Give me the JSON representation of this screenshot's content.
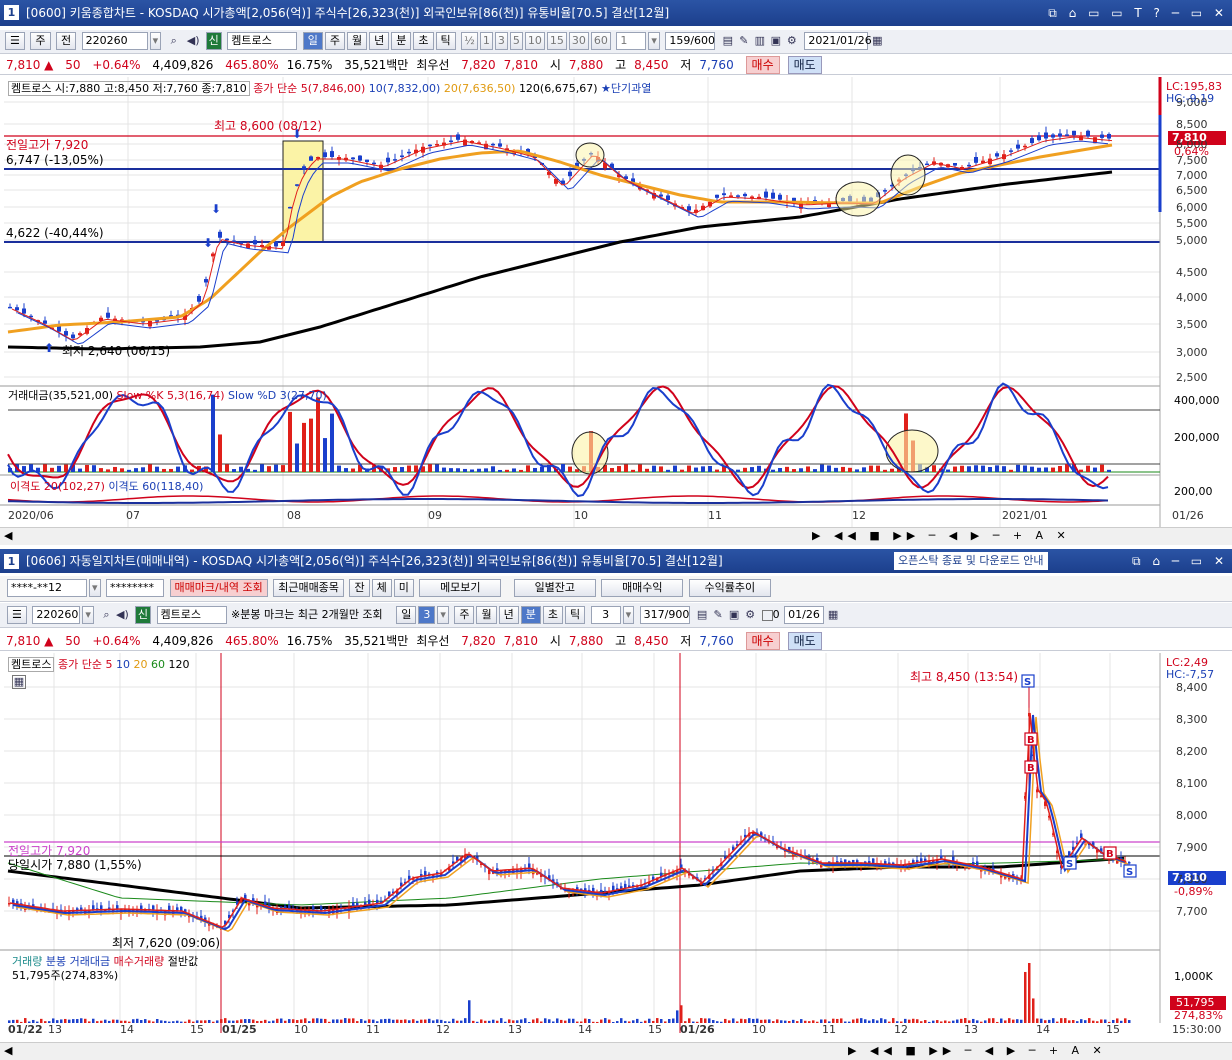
{
  "w1": {
    "title": "[0600] 키움종합차트 - KOSDAQ 시가총액[2,056(억)] 주식수[26,323(천)] 외국인보유[86(천)] 유통비율[70.5] 결산[12월]",
    "num": "1",
    "tb": {
      "week": "주",
      "jeon": "전",
      "code": "220260",
      "name": "켐트로스",
      "periods": [
        "일",
        "주",
        "월",
        "년",
        "분",
        "초",
        "틱"
      ],
      "ratios": [
        "½",
        "1",
        "3",
        "5",
        "10",
        "15",
        "30",
        "60"
      ],
      "one": "1",
      "count": "159/600",
      "date": "2021/01/26",
      "sin": "신"
    },
    "quote": {
      "price": "7,810 ▲",
      "chg": "50",
      "pct": "+0.64%",
      "vol": "4,409,826",
      "vr": "465.80%",
      "turn": "16.75%",
      "amt": "35,521백만",
      "bid_l": "최우선",
      "bid1": "7,820",
      "bid2": "7,810",
      "open_l": "시",
      "open": "7,880",
      "high_l": "고",
      "high": "8,450",
      "low_l": "저",
      "low": "7,760",
      "buy": "매수",
      "sell": "매도"
    },
    "legend": {
      "name": "켐트로스 시:7,880 고:8,450 저:7,760 종:7,810",
      "ma1": "종가 단순 5(7,846,00)",
      "ma2": "10(7,832,00)",
      "ma3": "20(7,636,50)",
      "ma4": "120(6,675,67)",
      "star": "★단기과열"
    },
    "labels": {
      "hi": "최고 8,600 (08/12)",
      "prev": "전일고가 7,920",
      "l1": "6,747 (-13,05%)",
      "l2": "4,622 (-40,44%)",
      "lo": "최저 2,640 (06/15)",
      "lc": "LC:195,83",
      "hc": "HC:-9,19",
      "px": "7,810",
      "pct": "0,64%"
    },
    "yticks": [
      "9,000",
      "8,500",
      "8,000",
      "7,500",
      "7,000",
      "6,500",
      "6,000",
      "5,500",
      "5,000",
      "4,500",
      "4,000",
      "3,500",
      "3,000",
      "2,500"
    ],
    "sub1": {
      "a": "거래대금(35,521,00)",
      "b": "Slow %K 5,3(16,74)",
      "c": "Slow %D 3(27,70)",
      "t1": "400,000",
      "t2": "200,000"
    },
    "sub2": {
      "a": "이격도 20(102,27)",
      "b": "이격도 60(118,40)",
      "t1": "200,00"
    },
    "xticks": [
      "2020/06",
      "07",
      "08",
      "09",
      "10",
      "11",
      "12",
      "2021/01",
      "01/26"
    ]
  },
  "w2": {
    "title": "[0606] 자동일지차트(매매내역) - KOSDAQ 시가총액[2,056(억)] 주식수[26,323(천)] 외국인보유[86(천)] 유통비율[70.5] 결산[12월]",
    "num": "1",
    "notice": "오픈스탁 종료 및 다운로드 안내",
    "acct": "****-**12",
    "pw": "********",
    "btns": [
      "매매마크/내역 조회",
      "최근매매종목",
      "잔",
      "체",
      "미",
      "메모보기",
      "일별잔고",
      "매매수익",
      "수익률추이"
    ],
    "tb": {
      "code": "220260",
      "name": "켐트로스",
      "note": "※분봉 마크는 최근 2개월만 조회",
      "il": "일",
      "three": "3",
      "periods": [
        "주",
        "월",
        "년",
        "분",
        "초",
        "틱"
      ],
      "n3": "3",
      "count": "317/900",
      "date": "01/26",
      "zero": "0",
      "sin": "신"
    },
    "quote": {
      "price": "7,810 ▲",
      "chg": "50",
      "pct": "+0.64%",
      "vol": "4,409,826",
      "vr": "465.80%",
      "turn": "16.75%",
      "amt": "35,521백만",
      "bid_l": "최우선",
      "bid1": "7,820",
      "bid2": "7,810",
      "open_l": "시",
      "open": "7,880",
      "high_l": "고",
      "high": "8,450",
      "low_l": "저",
      "low": "7,760",
      "buy": "매수",
      "sell": "매도"
    },
    "legend": {
      "name": "켐트로스",
      "ma": "종가 단순 5",
      "m10": "10",
      "m20": "20",
      "m60": "60",
      "m120": "120"
    },
    "labels": {
      "hi": "최고 8,450 (13:54)",
      "prev": "전일고가 7,920",
      "open": "당일시가 7,880 (1,55%)",
      "lo": "최저 7,620 (09:06)",
      "lc": "LC:2,49",
      "hc": "HC:-7,57",
      "px": "7,810",
      "pct": "-0,89%"
    },
    "yticks": [
      "8,400",
      "8,300",
      "8,200",
      "8,100",
      "8,000",
      "7,900",
      "7,800",
      "7,700"
    ],
    "vol": {
      "a": "거래량",
      "b": "분봉 거래대금",
      "c": "매수거래량",
      "d": "절반값",
      "val": "51,795주(274,83%)",
      "tick": "1,000K",
      "cur": "51,795",
      "cur2": "274,83%"
    },
    "xticks": [
      "01/22",
      "13",
      "14",
      "15",
      "01/25",
      "10",
      "11",
      "12",
      "13",
      "14",
      "15",
      "01/26",
      "10",
      "11",
      "12",
      "13",
      "14",
      "15",
      "15:30:00"
    ]
  },
  "colors": {
    "ma5": "#e0201a",
    "ma10": "#1a3fcc",
    "ma20": "#f0a020",
    "ma120": "#000000",
    "up": "#e0201a",
    "down": "#1a3fcc"
  }
}
